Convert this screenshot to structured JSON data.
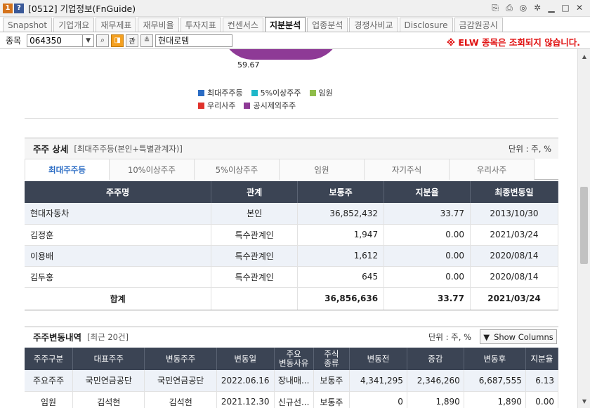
{
  "window": {
    "title": "[0512] 기업정보(FnGuide)"
  },
  "tabs": [
    "Snapshot",
    "기업개요",
    "재무제표",
    "재무비율",
    "투자지표",
    "컨센서스",
    "지분분석",
    "업종분석",
    "경쟁사비교",
    "Disclosure",
    "금감원공시"
  ],
  "active_tab": "지분분석",
  "search": {
    "label": "종목",
    "code": "064350",
    "company": "현대로템",
    "btn_gwan": "관",
    "warning": "※ ELW 종목은 조회되지 않습니다."
  },
  "pie": {
    "label": "59.67",
    "legend": [
      {
        "name": "최대주주등",
        "color": "#2b6cc4"
      },
      {
        "name": "5%이상주주",
        "color": "#1fb7c9"
      },
      {
        "name": "임원",
        "color": "#8fbd4a"
      },
      {
        "name": "우리사주",
        "color": "#e0322c"
      },
      {
        "name": "공시제외주주",
        "color": "#8e3a96"
      }
    ]
  },
  "section1": {
    "title": "주주 상세",
    "subtitle": "[최대주주등(본인+특별관계자)]",
    "unit": "단위 : 주, %",
    "subtabs": [
      "최대주주등",
      "10%이상주주",
      "5%이상주주",
      "임원",
      "자기주식",
      "우리사주"
    ],
    "columns": [
      "주주명",
      "관계",
      "보통주",
      "지분율",
      "최종변동일"
    ],
    "rows": [
      [
        "현대자동차",
        "본인",
        "36,852,432",
        "33.77",
        "2013/10/30"
      ],
      [
        "김정훈",
        "특수관계인",
        "1,947",
        "0.00",
        "2021/03/24"
      ],
      [
        "이용배",
        "특수관계인",
        "1,612",
        "0.00",
        "2020/08/14"
      ],
      [
        "김두홍",
        "특수관계인",
        "645",
        "0.00",
        "2020/08/14"
      ]
    ],
    "total": [
      "합계",
      "",
      "36,856,636",
      "33.77",
      "2021/03/24"
    ]
  },
  "section2": {
    "title": "주주변동내역",
    "subtitle": "[최근 20건]",
    "unit": "단위 : 주, %",
    "show_columns": "Show Columns",
    "columns": [
      "주주구분",
      "대표주주",
      "변동주주",
      "변동일",
      "주요\n변동사유",
      "주식\n종류",
      "변동전",
      "증감",
      "변동후",
      "지분율"
    ],
    "rows": [
      [
        "주요주주",
        "국민연금공단",
        "국민연금공단",
        "2022.06.16",
        "장내매...",
        "보통주",
        "4,341,295",
        "2,346,260",
        "6,687,555",
        "6.13"
      ],
      [
        "임원",
        "김석현",
        "김석현",
        "2021.12.30",
        "신규선...",
        "보통주",
        "0",
        "1,890",
        "1,890",
        "0.00"
      ]
    ]
  }
}
